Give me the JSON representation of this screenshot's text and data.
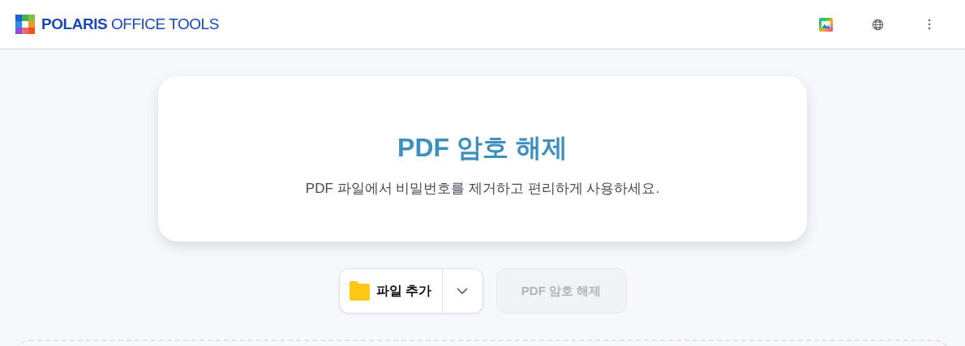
{
  "header": {
    "brand": "**POLARIS** OFFICE TOOLS"
  },
  "hero": {
    "title": "PDF 암호 해제",
    "subtitle": "PDF 파일에서 비밀번호를 제거하고 편리하게 사용하세요."
  },
  "actions": {
    "add_file": "파일 추가",
    "submit": {
      "label": "PDF 암호 해제",
      "disabled": true
    }
  }
}
